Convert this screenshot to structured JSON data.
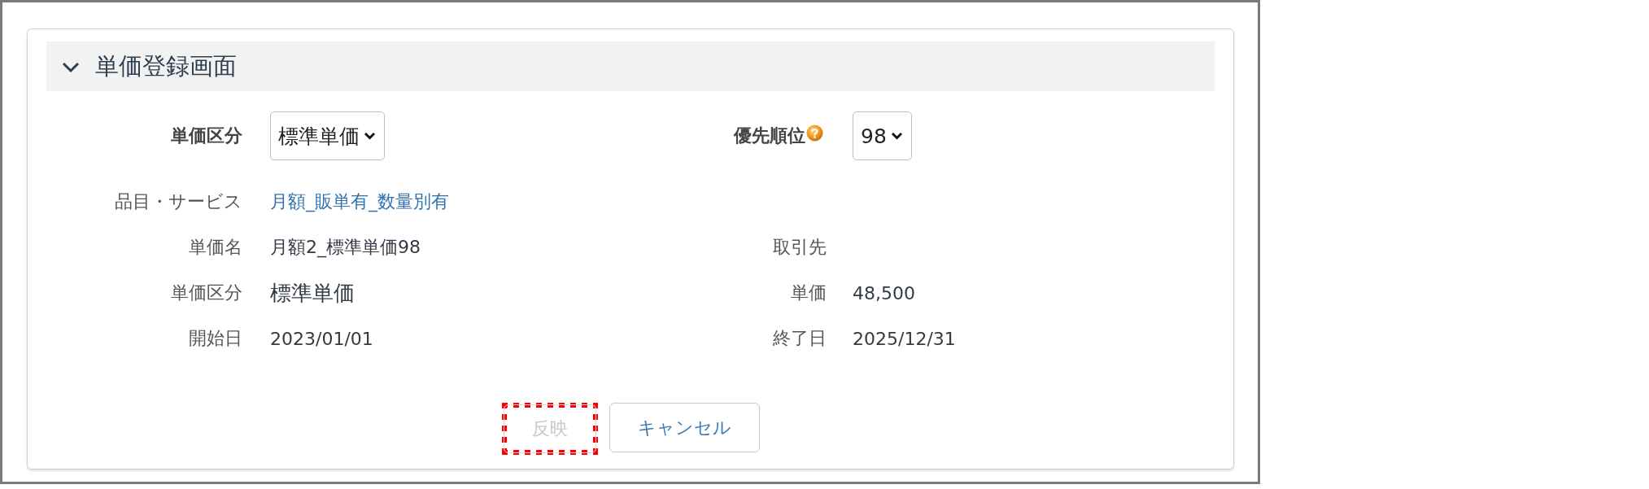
{
  "panel": {
    "title": "単価登録画面",
    "expanded": true
  },
  "selectors": [
    {
      "label": "単価区分",
      "value": "標準単価",
      "help": false
    },
    {
      "label": "優先順位",
      "value": "98",
      "help": true
    }
  ],
  "details": [
    {
      "left": {
        "label": "品目・サービス",
        "value": "月額_販単有_数量別有",
        "kind": "link"
      }
    },
    {
      "left": {
        "label": "単価名",
        "value": "月額2_標準単価98",
        "kind": "text"
      },
      "right": {
        "label": "取引先"
      }
    },
    {
      "left": {
        "label": "単価区分",
        "value": "標準単価",
        "kind": "large"
      },
      "right": {
        "label": "単価",
        "value": "48,500",
        "kind": "text"
      }
    },
    {
      "left": {
        "label": "開始日",
        "value": "2023/01/01",
        "kind": "text"
      },
      "right": {
        "label": "終了日",
        "value": "2025/12/31",
        "kind": "text"
      }
    }
  ],
  "buttons": [
    {
      "label": "反映",
      "disabled": true,
      "highlighted": true
    },
    {
      "label": "キャンセル",
      "disabled": false,
      "highlighted": false
    }
  ]
}
